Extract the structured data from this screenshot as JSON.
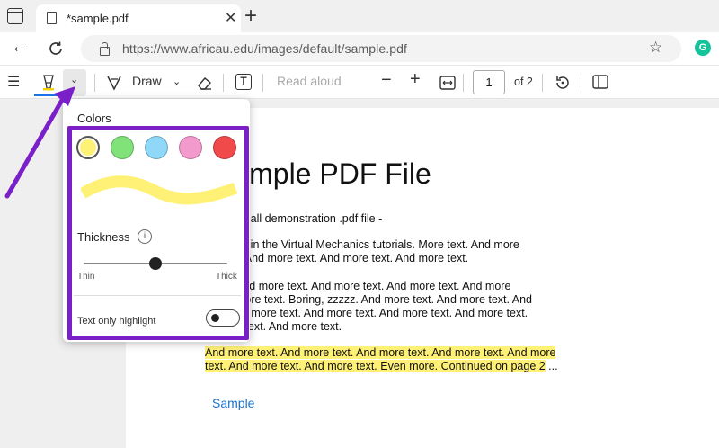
{
  "browser": {
    "tab_title": "*sample.pdf",
    "tab_close": "✕",
    "new_tab": "+",
    "url": "https://www.africau.edu/images/default/sample.pdf",
    "grammarly_glyph": "G"
  },
  "pdf_toolbar": {
    "draw_label": "Draw",
    "read_aloud_label": "Read aloud",
    "page_current": "1",
    "page_total_label": "of 2",
    "zoom_out": "−",
    "zoom_in": "+"
  },
  "highlight_popup": {
    "colors_label": "Colors",
    "swatches": [
      {
        "name": "yellow",
        "color": "#fff176",
        "selected": true
      },
      {
        "name": "green",
        "color": "#81e27a",
        "selected": false
      },
      {
        "name": "blue",
        "color": "#8fd8f7",
        "selected": false
      },
      {
        "name": "pink",
        "color": "#f39acd",
        "selected": false
      },
      {
        "name": "red",
        "color": "#f14a4a",
        "selected": false
      }
    ],
    "preview_color": "#fff176",
    "thickness_label": "Thickness",
    "thickness_value": 0.5,
    "thin_label": "Thin",
    "thick_label": "Thick",
    "text_only_label": "Text only highlight",
    "text_only_enabled": false
  },
  "pdf_page": {
    "title": "imple PDF File",
    "line1": "small demonstration .pdf file -",
    "para1": [
      "se in the Virtual Mechanics tutorials. More text. And more",
      "t. And more text. And more text. And more text."
    ],
    "para2": [
      "And more text. And more text. And more text. And more",
      "more text. Boring, zzzzz. And more text. And more text. And",
      "nd more text. And more text. And more text. And more text.",
      "e text. And more text."
    ],
    "highlighted": [
      "And more text. And more text. And more text. And more text. And more",
      "text. And more text. And more text. Even more. Continued on page 2"
    ],
    "ellipsis": " ...",
    "link": "Sample"
  },
  "annotation_color": "#7b1fc9"
}
